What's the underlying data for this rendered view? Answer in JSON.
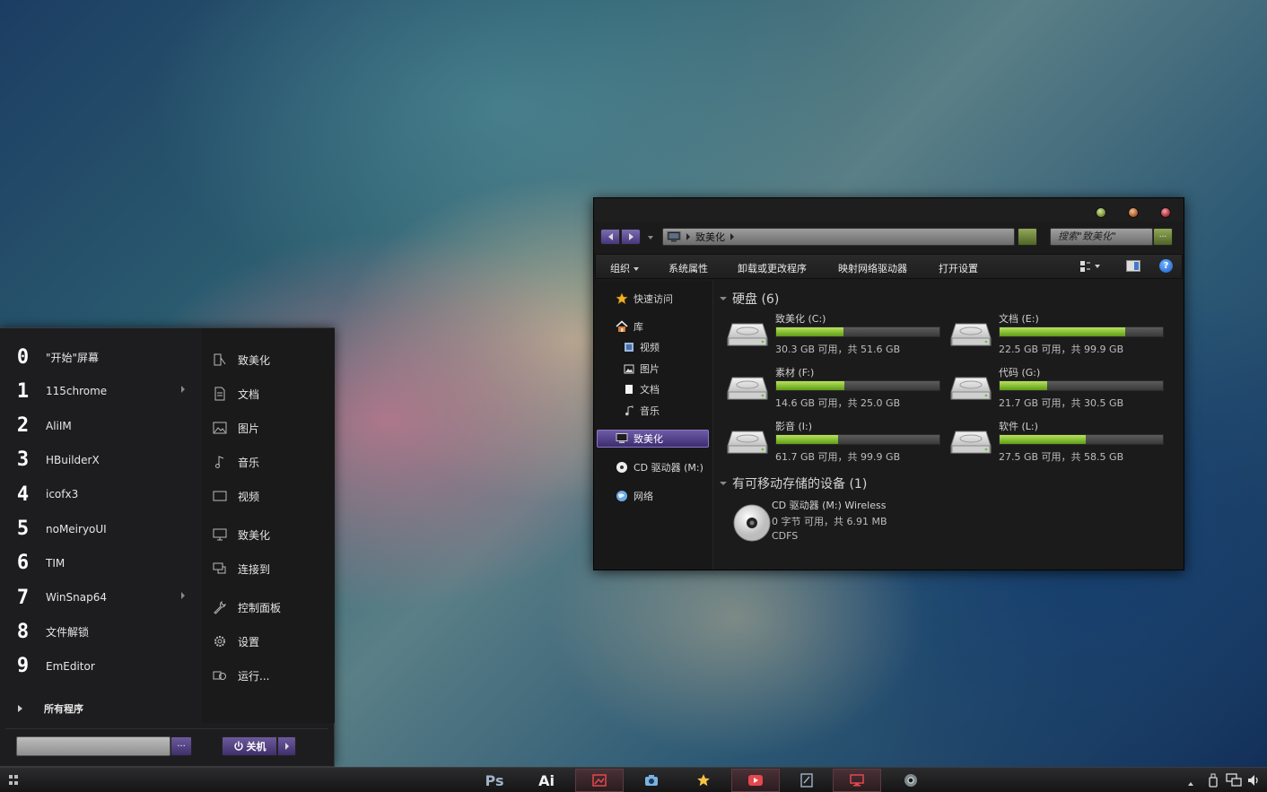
{
  "start_menu": {
    "pinned": [
      {
        "num": "0",
        "label": "\"开始\"屏幕",
        "has_submenu": false
      },
      {
        "num": "1",
        "label": "115chrome",
        "has_submenu": true
      },
      {
        "num": "2",
        "label": "AliIM",
        "has_submenu": false
      },
      {
        "num": "3",
        "label": "HBuilderX",
        "has_submenu": false
      },
      {
        "num": "4",
        "label": "icofx3",
        "has_submenu": false
      },
      {
        "num": "5",
        "label": "noMeiryoUI",
        "has_submenu": false
      },
      {
        "num": "6",
        "label": "TIM",
        "has_submenu": false
      },
      {
        "num": "7",
        "label": "WinSnap64",
        "has_submenu": true
      },
      {
        "num": "8",
        "label": "文件解锁",
        "has_submenu": false
      },
      {
        "num": "9",
        "label": "EmEditor",
        "has_submenu": false
      }
    ],
    "all_programs": "所有程序",
    "places": [
      {
        "label": "致美化",
        "icon": "user-icon"
      },
      {
        "label": "文档",
        "icon": "document-icon"
      },
      {
        "label": "图片",
        "icon": "picture-icon"
      },
      {
        "label": "音乐",
        "icon": "music-icon"
      },
      {
        "label": "视频",
        "icon": "video-icon"
      },
      {
        "label": "致美化",
        "icon": "computer-icon"
      },
      {
        "label": "连接到",
        "icon": "connect-icon"
      },
      {
        "label": "控制面板",
        "icon": "wrench-icon"
      },
      {
        "label": "设置",
        "icon": "gear-icon"
      },
      {
        "label": "运行...",
        "icon": "run-icon"
      }
    ],
    "search_button": "...",
    "shutdown_label": "关机"
  },
  "explorer": {
    "breadcrumb": "致美化",
    "search_placeholder": "搜索\"致美化\"",
    "search_button": "...",
    "commands": [
      "组织",
      "系统属性",
      "卸载或更改程序",
      "映射网络驱动器",
      "打开设置"
    ],
    "help": "?",
    "nav": {
      "quick_access": "快速访问",
      "library": "库",
      "library_items": [
        "视频",
        "图片",
        "文档",
        "音乐"
      ],
      "computer": "致美化",
      "cd_drive": "CD 驱动器 (M:)",
      "network": "网络"
    },
    "hard_disks_header": "硬盘 (6)",
    "drives": [
      {
        "name": "致美化 (C:)",
        "free_text": "30.3 GB 可用，共 51.6 GB",
        "used_fraction": 0.41
      },
      {
        "name": "文档 (E:)",
        "free_text": "22.5 GB 可用，共 99.9 GB",
        "used_fraction": 0.77
      },
      {
        "name": "素材 (F:)",
        "free_text": "14.6 GB 可用，共 25.0 GB",
        "used_fraction": 0.42
      },
      {
        "name": "代码 (G:)",
        "free_text": "21.7 GB 可用，共 30.5 GB",
        "used_fraction": 0.29
      },
      {
        "name": "影音 (I:)",
        "free_text": "61.7 GB 可用，共 99.9 GB",
        "used_fraction": 0.38
      },
      {
        "name": "软件 (L:)",
        "free_text": "27.5 GB 可用，共 58.5 GB",
        "used_fraction": 0.53
      }
    ],
    "removable_header": "有可移动存储的设备 (1)",
    "cd_device": {
      "line1": "CD 驱动器 (M:) Wireless",
      "line2": "0 字节 可用，共 6.91 MB",
      "line3": "CDFS"
    }
  },
  "taskbar": {
    "apps": [
      {
        "label": "Ps",
        "icon": "photoshop-icon"
      },
      {
        "label": "Ai",
        "icon": "illustrator-icon"
      },
      {
        "label": "",
        "icon": "image-viewer-icon"
      },
      {
        "label": "",
        "icon": "camera-icon"
      },
      {
        "label": "",
        "icon": "star-icon"
      },
      {
        "label": "",
        "icon": "media-player-icon"
      },
      {
        "label": "",
        "icon": "notepad-icon"
      },
      {
        "label": "",
        "icon": "remote-desktop-icon"
      },
      {
        "label": "",
        "icon": "chrome-icon"
      }
    ],
    "tray": [
      "show-hidden-icon",
      "usb-icon",
      "network-icon",
      "volume-icon"
    ]
  },
  "colors": {
    "accent_purple": "#5b4792",
    "go_green": "#6f8a2e",
    "drive_bar_green": "#8cc63e"
  }
}
